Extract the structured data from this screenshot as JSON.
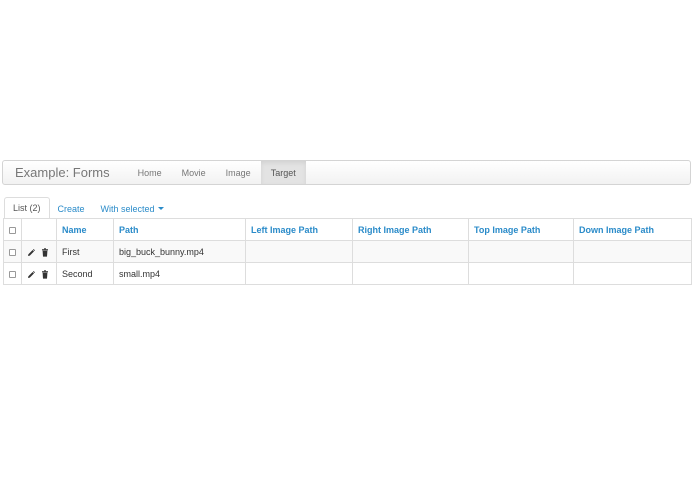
{
  "navbar": {
    "brand": "Example: Forms",
    "items": [
      {
        "label": "Home",
        "active": false
      },
      {
        "label": "Movie",
        "active": false
      },
      {
        "label": "Image",
        "active": false
      },
      {
        "label": "Target",
        "active": true
      }
    ]
  },
  "tabs": {
    "list_label": "List (2)",
    "create_label": "Create",
    "with_selected_label": "With selected"
  },
  "table": {
    "columns": [
      "Name",
      "Path",
      "Left Image Path",
      "Right Image Path",
      "Top Image Path",
      "Down Image Path"
    ],
    "rows": [
      {
        "name": "First",
        "path": "big_buck_bunny.mp4",
        "left": "",
        "right": "",
        "top": "",
        "down": ""
      },
      {
        "name": "Second",
        "path": "small.mp4",
        "left": "",
        "right": "",
        "top": "",
        "down": ""
      }
    ]
  },
  "icons": {
    "edit": "pencil-icon",
    "delete": "trash-icon",
    "dropdown": "caret-down-icon"
  },
  "colors": {
    "link": "#2a8bc9",
    "active_nav_bg": "#e3e3e3",
    "navbar_border": "#d4d4d4"
  }
}
